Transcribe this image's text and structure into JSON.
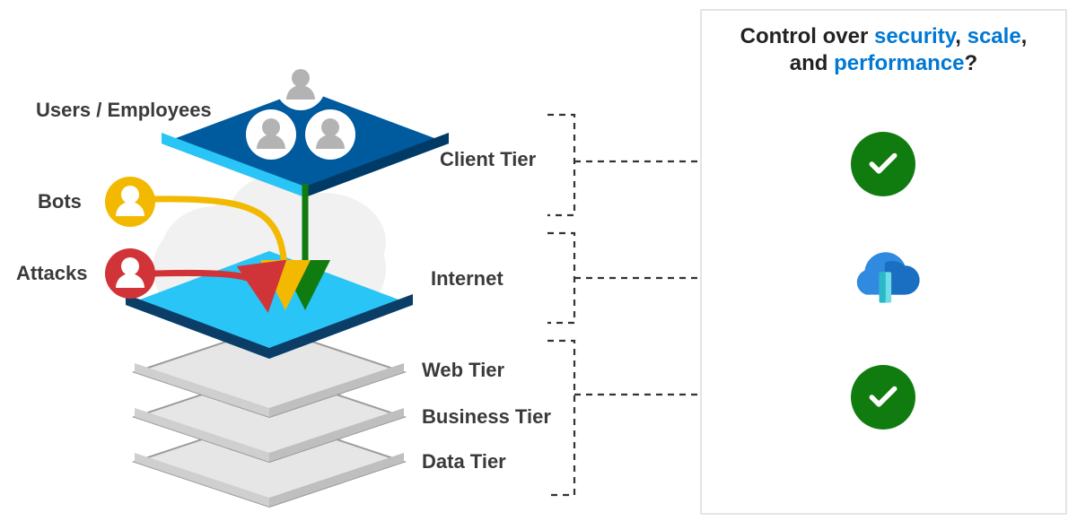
{
  "labels": {
    "users": "Users / Employees",
    "bots": "Bots",
    "attacks": "Attacks",
    "client_tier": "Client Tier",
    "internet": "Internet",
    "web_tier": "Web Tier",
    "business_tier": "Business Tier",
    "data_tier": "Data Tier"
  },
  "question": {
    "pre": "Control over ",
    "hl1": "security",
    "sep1": ", ",
    "hl2": "scale",
    "line2_pre": "and ",
    "hl3": "performance",
    "suffix": "?"
  },
  "actors": {
    "bots_color": "#f2b900",
    "attacks_color": "#d13438",
    "users_color": "#b3b3b3"
  },
  "tiers": {
    "client_fill": "#005a9e",
    "client_edge": "#29c5f6",
    "internet_fill": "#29c5f6",
    "internet_edge": "#0b3d66",
    "stack_fill": "#e6e6e6",
    "stack_edge": "#9b9b9b"
  },
  "arrows": {
    "users_color": "#107c10",
    "bots_color": "#f2b900",
    "attacks_color": "#d13438"
  },
  "right": {
    "check_color": "#107c10",
    "frontdoor_cloud": "#2f8ae0",
    "frontdoor_cloud_dark": "#1b6fc2",
    "frontdoor_door": "#6fdce6"
  },
  "semantics": {
    "diagram_kind": "layered-architecture",
    "left_stack": [
      "Client Tier",
      "Internet",
      "Web Tier",
      "Business Tier",
      "Data Tier"
    ],
    "threats_into_internet": [
      "Users / Employees",
      "Bots",
      "Attacks"
    ],
    "right_groups": [
      {
        "covers": [
          "Client Tier"
        ],
        "status": "controlled"
      },
      {
        "covers": [
          "Internet"
        ],
        "status": "azure-front-door"
      },
      {
        "covers": [
          "Web Tier",
          "Business Tier",
          "Data Tier"
        ],
        "status": "controlled"
      }
    ]
  }
}
